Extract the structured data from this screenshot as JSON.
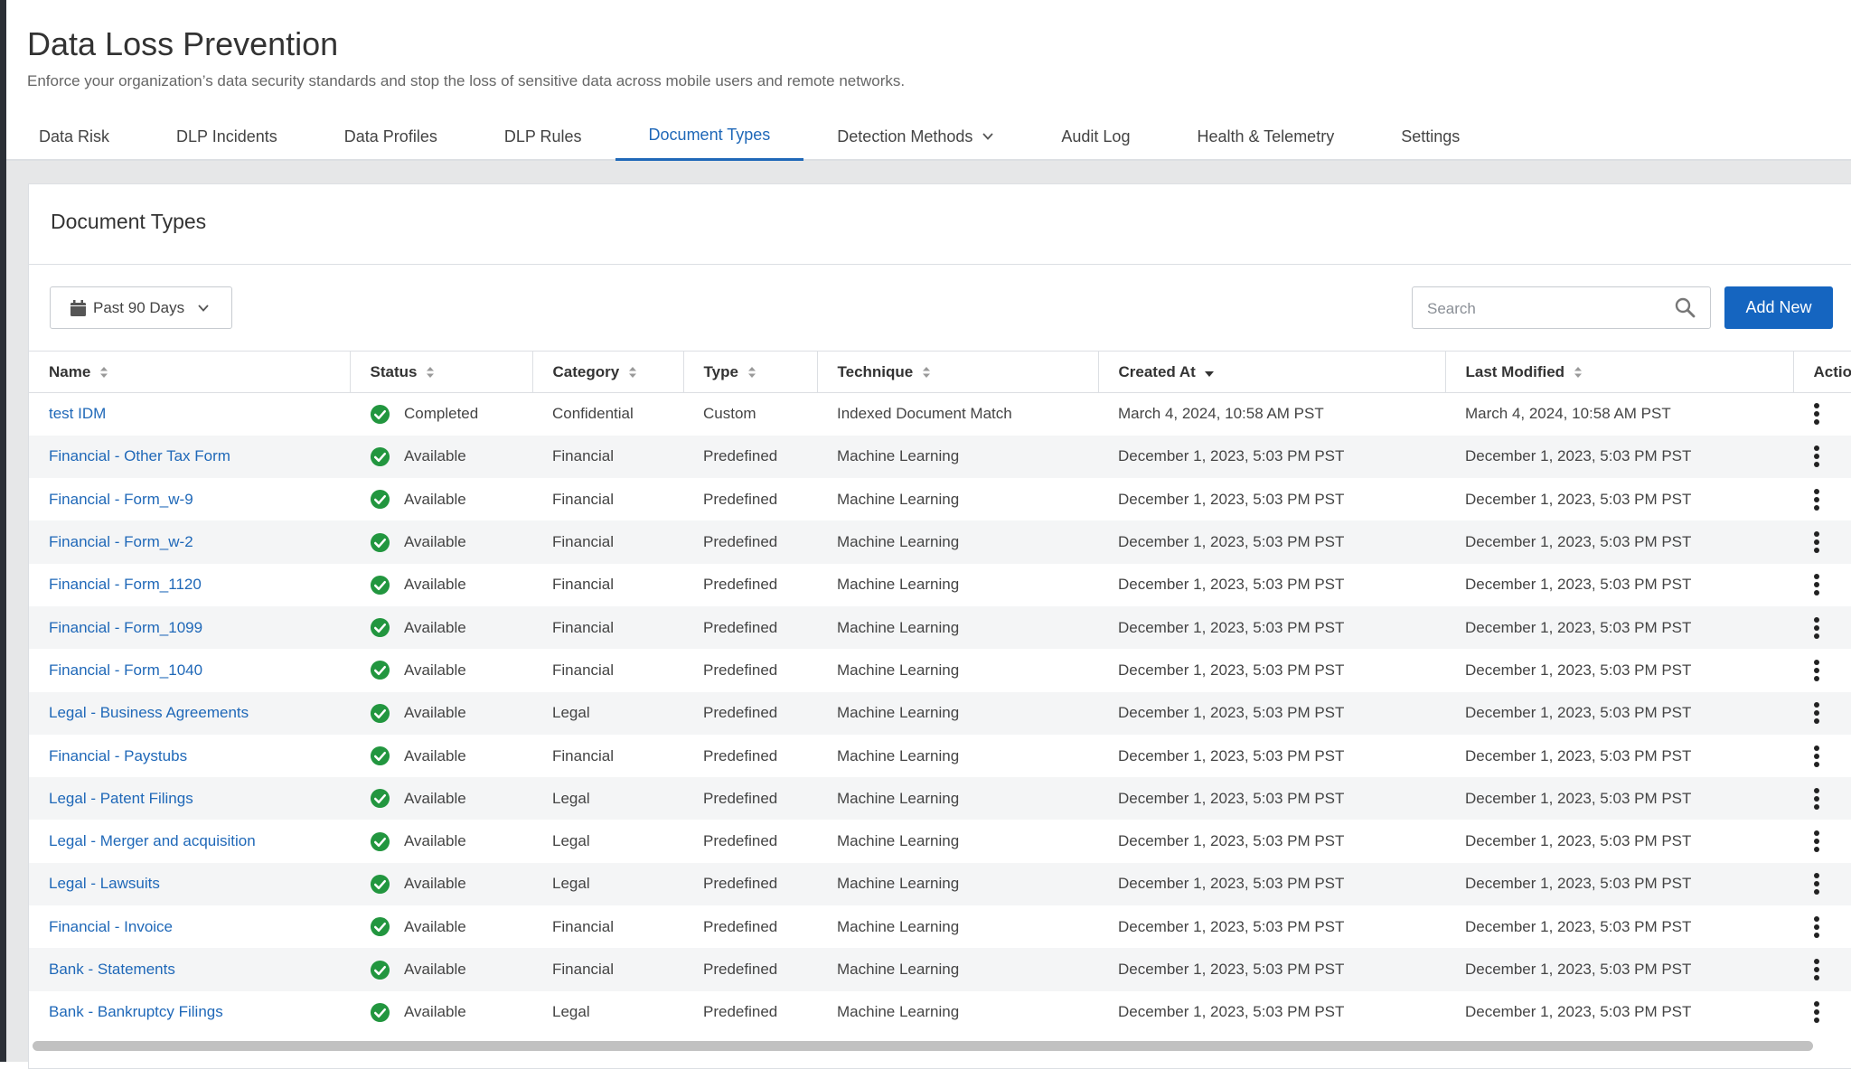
{
  "page": {
    "title": "Data Loss Prevention",
    "subtitle": "Enforce your organization’s data security standards and stop the loss of sensitive data across mobile users and remote networks."
  },
  "tabs": [
    {
      "label": "Data Risk"
    },
    {
      "label": "DLP Incidents"
    },
    {
      "label": "Data Profiles"
    },
    {
      "label": "DLP Rules"
    },
    {
      "label": "Document Types",
      "active": true
    },
    {
      "label": "Detection Methods",
      "dropdown": true
    },
    {
      "label": "Audit Log"
    },
    {
      "label": "Health & Telemetry"
    },
    {
      "label": "Settings"
    }
  ],
  "card": {
    "title": "Document Types"
  },
  "toolbar": {
    "date_filter": "Past 90 Days",
    "search_placeholder": "Search",
    "add_label": "Add New"
  },
  "table": {
    "columns": [
      "Name",
      "Status",
      "Category",
      "Type",
      "Technique",
      "Created At",
      "Last Modified",
      "Actio"
    ],
    "sorted_column": "Created At",
    "rows": [
      {
        "name": "test IDM",
        "status": "Completed",
        "category": "Confidential",
        "type": "Custom",
        "technique": "Indexed Document Match",
        "created": "March 4, 2024, 10:58 AM PST",
        "modified": "March 4, 2024, 10:58 AM PST"
      },
      {
        "name": "Financial - Other Tax Form",
        "status": "Available",
        "category": "Financial",
        "type": "Predefined",
        "technique": "Machine Learning",
        "created": "December 1, 2023, 5:03 PM PST",
        "modified": "December 1, 2023, 5:03 PM PST"
      },
      {
        "name": "Financial - Form_w-9",
        "status": "Available",
        "category": "Financial",
        "type": "Predefined",
        "technique": "Machine Learning",
        "created": "December 1, 2023, 5:03 PM PST",
        "modified": "December 1, 2023, 5:03 PM PST"
      },
      {
        "name": "Financial - Form_w-2",
        "status": "Available",
        "category": "Financial",
        "type": "Predefined",
        "technique": "Machine Learning",
        "created": "December 1, 2023, 5:03 PM PST",
        "modified": "December 1, 2023, 5:03 PM PST"
      },
      {
        "name": "Financial - Form_1120",
        "status": "Available",
        "category": "Financial",
        "type": "Predefined",
        "technique": "Machine Learning",
        "created": "December 1, 2023, 5:03 PM PST",
        "modified": "December 1, 2023, 5:03 PM PST"
      },
      {
        "name": "Financial - Form_1099",
        "status": "Available",
        "category": "Financial",
        "type": "Predefined",
        "technique": "Machine Learning",
        "created": "December 1, 2023, 5:03 PM PST",
        "modified": "December 1, 2023, 5:03 PM PST"
      },
      {
        "name": "Financial - Form_1040",
        "status": "Available",
        "category": "Financial",
        "type": "Predefined",
        "technique": "Machine Learning",
        "created": "December 1, 2023, 5:03 PM PST",
        "modified": "December 1, 2023, 5:03 PM PST"
      },
      {
        "name": "Legal - Business Agreements",
        "status": "Available",
        "category": "Legal",
        "type": "Predefined",
        "technique": "Machine Learning",
        "created": "December 1, 2023, 5:03 PM PST",
        "modified": "December 1, 2023, 5:03 PM PST"
      },
      {
        "name": "Financial - Paystubs",
        "status": "Available",
        "category": "Financial",
        "type": "Predefined",
        "technique": "Machine Learning",
        "created": "December 1, 2023, 5:03 PM PST",
        "modified": "December 1, 2023, 5:03 PM PST"
      },
      {
        "name": "Legal - Patent Filings",
        "status": "Available",
        "category": "Legal",
        "type": "Predefined",
        "technique": "Machine Learning",
        "created": "December 1, 2023, 5:03 PM PST",
        "modified": "December 1, 2023, 5:03 PM PST"
      },
      {
        "name": "Legal - Merger and acquisition",
        "status": "Available",
        "category": "Legal",
        "type": "Predefined",
        "technique": "Machine Learning",
        "created": "December 1, 2023, 5:03 PM PST",
        "modified": "December 1, 2023, 5:03 PM PST"
      },
      {
        "name": "Legal - Lawsuits",
        "status": "Available",
        "category": "Legal",
        "type": "Predefined",
        "technique": "Machine Learning",
        "created": "December 1, 2023, 5:03 PM PST",
        "modified": "December 1, 2023, 5:03 PM PST"
      },
      {
        "name": "Financial - Invoice",
        "status": "Available",
        "category": "Financial",
        "type": "Predefined",
        "technique": "Machine Learning",
        "created": "December 1, 2023, 5:03 PM PST",
        "modified": "December 1, 2023, 5:03 PM PST"
      },
      {
        "name": "Bank - Statements",
        "status": "Available",
        "category": "Financial",
        "type": "Predefined",
        "technique": "Machine Learning",
        "created": "December 1, 2023, 5:03 PM PST",
        "modified": "December 1, 2023, 5:03 PM PST"
      },
      {
        "name": "Bank - Bankruptcy Filings",
        "status": "Available",
        "category": "Legal",
        "type": "Predefined",
        "technique": "Machine Learning",
        "created": "December 1, 2023, 5:03 PM PST",
        "modified": "December 1, 2023, 5:03 PM PST"
      }
    ]
  },
  "colors": {
    "accent": "#1f68b8",
    "button": "#1565c0",
    "success": "#22963f"
  },
  "icons": {
    "status": "check-circle-icon",
    "row_actions": "kebab-icon",
    "date_filter": "calendar-icon",
    "search": "search-icon"
  }
}
